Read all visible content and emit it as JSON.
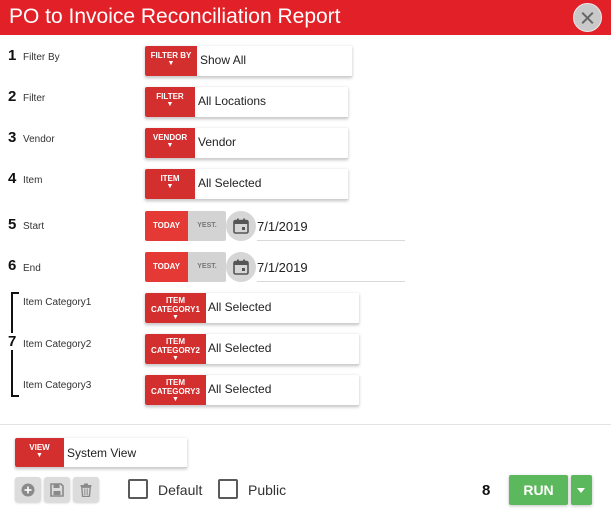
{
  "title": "PO to Invoice Reconciliation Report",
  "colors": {
    "titlebar": "#e12127",
    "button_red": "#d32f2f",
    "run_green": "#5cb85c"
  },
  "rows": [
    {
      "number": "1",
      "label": "Filter By",
      "button": "FILTER BY",
      "value": "Show All"
    },
    {
      "number": "2",
      "label": "Filter",
      "button": "FILTER",
      "value": "All Locations"
    },
    {
      "number": "3",
      "label": "Vendor",
      "button": "VENDOR",
      "value": "Vendor"
    },
    {
      "number": "4",
      "label": "Item",
      "button": "ITEM",
      "value": "All Selected"
    }
  ],
  "dates": [
    {
      "number": "5",
      "label": "Start",
      "today": "TODAY",
      "yest": "YEST.",
      "value": "7/1/2019"
    },
    {
      "number": "6",
      "label": "End",
      "today": "TODAY",
      "yest": "YEST.",
      "value": "7/1/2019"
    }
  ],
  "categories": {
    "number": "7",
    "items": [
      {
        "label": "Item Category1",
        "button_line1": "ITEM",
        "button_line2": "CATEGORY1",
        "value": "All Selected"
      },
      {
        "label": "Item Category2",
        "button_line1": "ITEM",
        "button_line2": "CATEGORY2",
        "value": "All Selected"
      },
      {
        "label": "Item Category3",
        "button_line1": "ITEM",
        "button_line2": "CATEGORY3",
        "value": "All Selected"
      }
    ]
  },
  "view": {
    "button": "VIEW",
    "value": "System View"
  },
  "view_actions": {
    "add_icon": "plus-circle-icon",
    "save_icon": "floppy-disk-icon",
    "delete_icon": "trash-icon"
  },
  "checkboxes": {
    "default_label": "Default",
    "public_label": "Public"
  },
  "run": {
    "number": "8",
    "label": "RUN"
  },
  "arrow": "▼"
}
